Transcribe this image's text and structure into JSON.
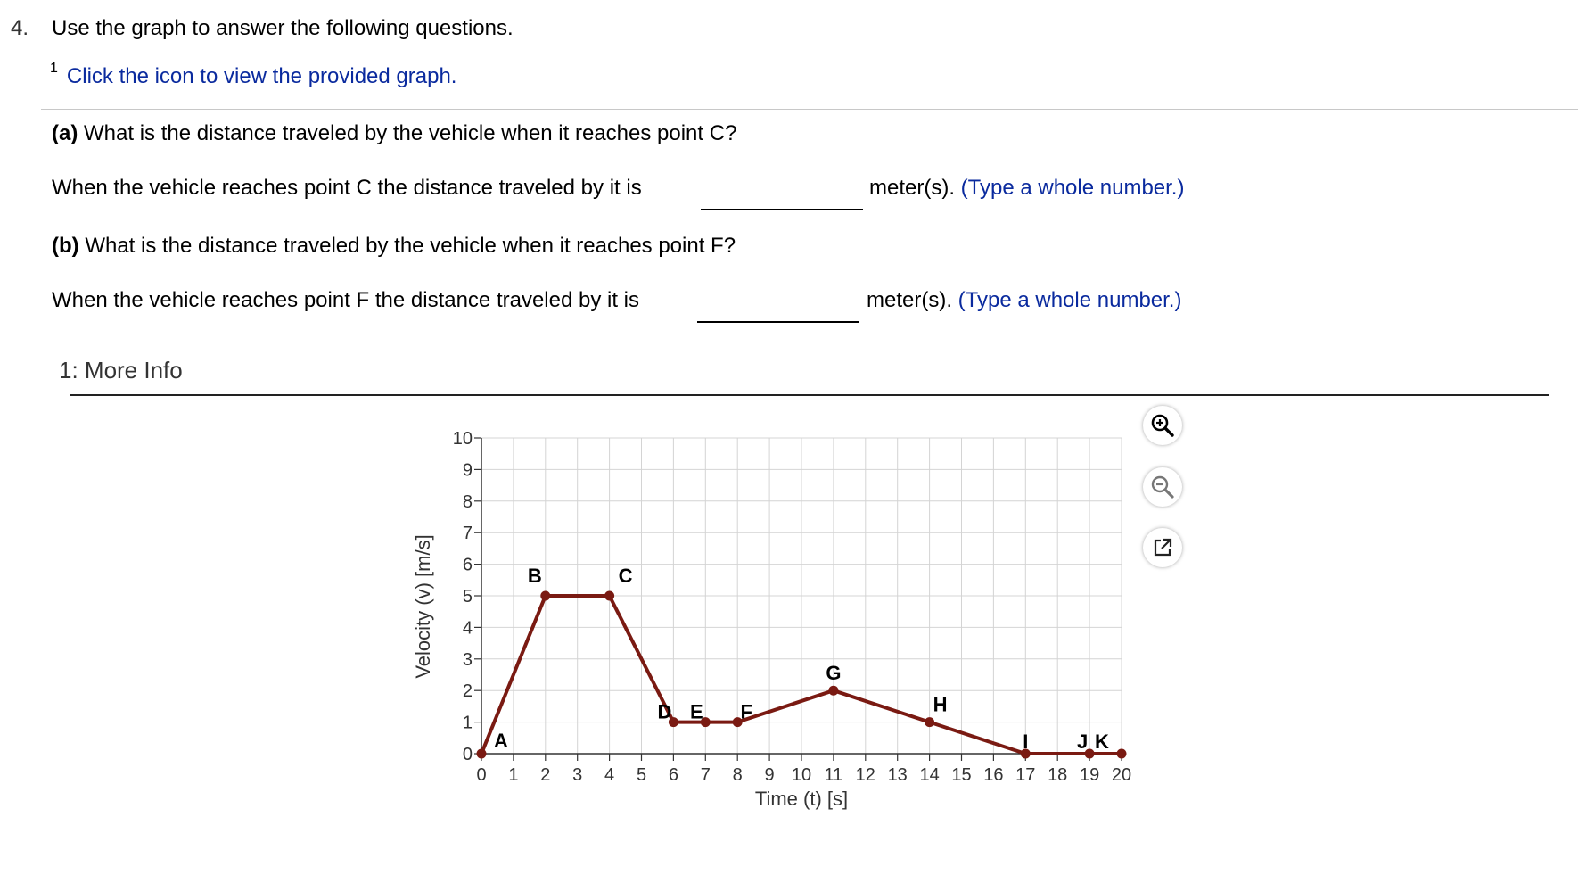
{
  "question": {
    "number": "4.",
    "prompt": "Use the graph to answer the following questions.",
    "footnote_marker": "1",
    "footnote_link": "Click the icon to view the provided graph.",
    "part_a": {
      "tag": "(a)",
      "question": "What is the distance traveled by the vehicle when it reaches point C?",
      "answer_prefix": "When the vehicle reaches point C the distance traveled by it is",
      "answer_value": "",
      "unit": "meter(s).",
      "hint": "(Type a whole number.)"
    },
    "part_b": {
      "tag": "(b)",
      "question": "What is the distance traveled by the vehicle when it reaches point F?",
      "answer_prefix": "When the vehicle reaches point F the distance traveled by it is",
      "answer_value": "",
      "unit": "meter(s).",
      "hint": "(Type a whole number.)"
    }
  },
  "more_info": {
    "title": "1: More Info"
  },
  "toolbar": {
    "zoom_in_icon": "zoom-in-icon",
    "zoom_out_icon": "zoom-out-icon",
    "popout_icon": "external-link-icon"
  },
  "chart_data": {
    "type": "line",
    "xlabel": "Time (t) [s]",
    "ylabel": "Velocity (v) [m/s]",
    "xlim": [
      0,
      20
    ],
    "ylim": [
      0,
      10
    ],
    "grid": true,
    "line_color": "#7a1a12",
    "x_ticks": [
      "0",
      "1",
      "2",
      "3",
      "4",
      "5",
      "6",
      "7",
      "8",
      "9",
      "10",
      "11",
      "12",
      "13",
      "14",
      "15",
      "16",
      "17",
      "18",
      "19",
      "20"
    ],
    "y_ticks": [
      "0",
      "1",
      "2",
      "3",
      "4",
      "5",
      "6",
      "7",
      "8",
      "9",
      "10"
    ],
    "points": [
      {
        "label": "A",
        "x": 0,
        "y": 0
      },
      {
        "label": "B",
        "x": 2,
        "y": 5
      },
      {
        "label": "C",
        "x": 4,
        "y": 5
      },
      {
        "label": "D",
        "x": 6,
        "y": 1
      },
      {
        "label": "E",
        "x": 7,
        "y": 1
      },
      {
        "label": "F",
        "x": 8,
        "y": 1
      },
      {
        "label": "G",
        "x": 11,
        "y": 2
      },
      {
        "label": "H",
        "x": 14,
        "y": 1
      },
      {
        "label": "I",
        "x": 17,
        "y": 0
      },
      {
        "label": "J",
        "x": 19,
        "y": 0
      },
      {
        "label": "K",
        "x": 20,
        "y": 0
      }
    ]
  }
}
